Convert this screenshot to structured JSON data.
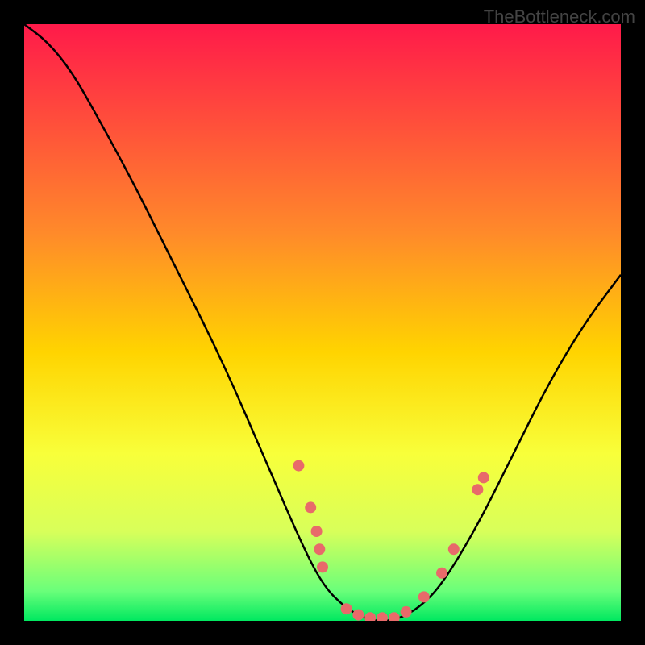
{
  "watermark": "TheBottleneck.com",
  "chart_data": {
    "type": "line",
    "title": "",
    "xlabel": "",
    "ylabel": "",
    "xlim": [
      0,
      100
    ],
    "ylim": [
      0,
      100
    ],
    "gradient_stops": [
      {
        "offset": 0,
        "color": "#ff1a4a"
      },
      {
        "offset": 0.35,
        "color": "#ff8a2a"
      },
      {
        "offset": 0.55,
        "color": "#ffd400"
      },
      {
        "offset": 0.72,
        "color": "#f8ff3a"
      },
      {
        "offset": 0.85,
        "color": "#d8ff5a"
      },
      {
        "offset": 0.95,
        "color": "#6aff7a"
      },
      {
        "offset": 1.0,
        "color": "#00e860"
      }
    ],
    "series": [
      {
        "name": "bottleneck-curve",
        "x": [
          0,
          4,
          8,
          12,
          18,
          25,
          33,
          40,
          46,
          50,
          54,
          58,
          62,
          66,
          70,
          76,
          82,
          88,
          94,
          100
        ],
        "y": [
          100,
          97,
          92,
          85,
          74,
          60,
          44,
          28,
          14,
          6,
          2,
          0,
          0,
          2,
          6,
          16,
          28,
          40,
          50,
          58
        ]
      }
    ],
    "scatter_points": {
      "name": "highlight-dots",
      "color": "#e86a6a",
      "points": [
        {
          "x": 46,
          "y": 26
        },
        {
          "x": 48,
          "y": 19
        },
        {
          "x": 49,
          "y": 15
        },
        {
          "x": 49.5,
          "y": 12
        },
        {
          "x": 50,
          "y": 9
        },
        {
          "x": 54,
          "y": 2
        },
        {
          "x": 56,
          "y": 1
        },
        {
          "x": 58,
          "y": 0.5
        },
        {
          "x": 60,
          "y": 0.5
        },
        {
          "x": 62,
          "y": 0.5
        },
        {
          "x": 64,
          "y": 1.5
        },
        {
          "x": 67,
          "y": 4
        },
        {
          "x": 70,
          "y": 8
        },
        {
          "x": 72,
          "y": 12
        },
        {
          "x": 76,
          "y": 22
        },
        {
          "x": 77,
          "y": 24
        }
      ]
    }
  }
}
